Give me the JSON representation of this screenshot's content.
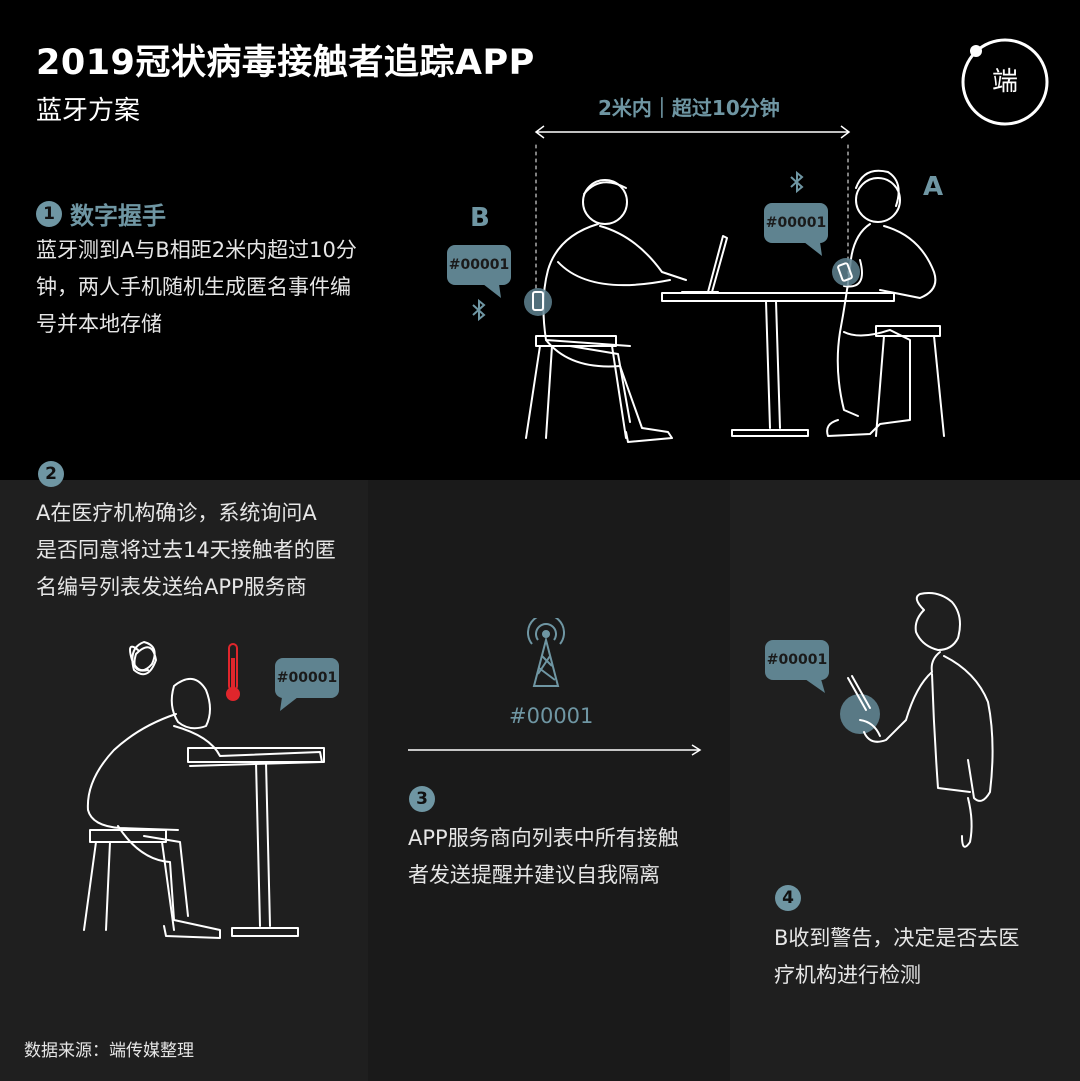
{
  "header": {
    "title": "2019冠状病毒接触者追踪APP",
    "subtitle": "蓝牙方案",
    "logo_text": "端"
  },
  "measure_label": "2米内｜超过10分钟",
  "step1": {
    "number": "1",
    "title": "数字握手",
    "lines": [
      "蓝牙测到A与B相距2米内超过10分",
      "钟，两人手机随机生成匿名事件编",
      "号并本地存储"
    ]
  },
  "labels": {
    "person_a": "A",
    "person_b": "B"
  },
  "bubbles": {
    "b_id": "#00001",
    "a_id": "#00001",
    "sick_id": "#00001",
    "receiver_id": "#00001"
  },
  "step2": {
    "number": "2",
    "lines": [
      "A在医疗机构确诊，系统询问A",
      "是否同意将过去14天接触者的匿",
      "名编号列表发送给APP服务商"
    ]
  },
  "tower_code": "#00001",
  "step3": {
    "number": "3",
    "lines": [
      "APP服务商向列表中所有接触",
      "者发送提醒并建议自我隔离"
    ]
  },
  "step4": {
    "number": "4",
    "lines": [
      "B收到警告，决定是否去医",
      "疗机构进行检测"
    ]
  },
  "source": "数据来源：端传媒整理",
  "colors": {
    "accent": "#6f96a3",
    "bubble": "#5f8390",
    "panel_left": "#1f1f1f",
    "panel_mid": "#1a1a1a",
    "panel_right": "#1f1f1f",
    "thermometer": "#e0262c"
  },
  "icons": [
    "bluetooth-icon",
    "signal-tower-icon",
    "thermometer-icon",
    "scribble-icon",
    "arrow-right-icon"
  ]
}
